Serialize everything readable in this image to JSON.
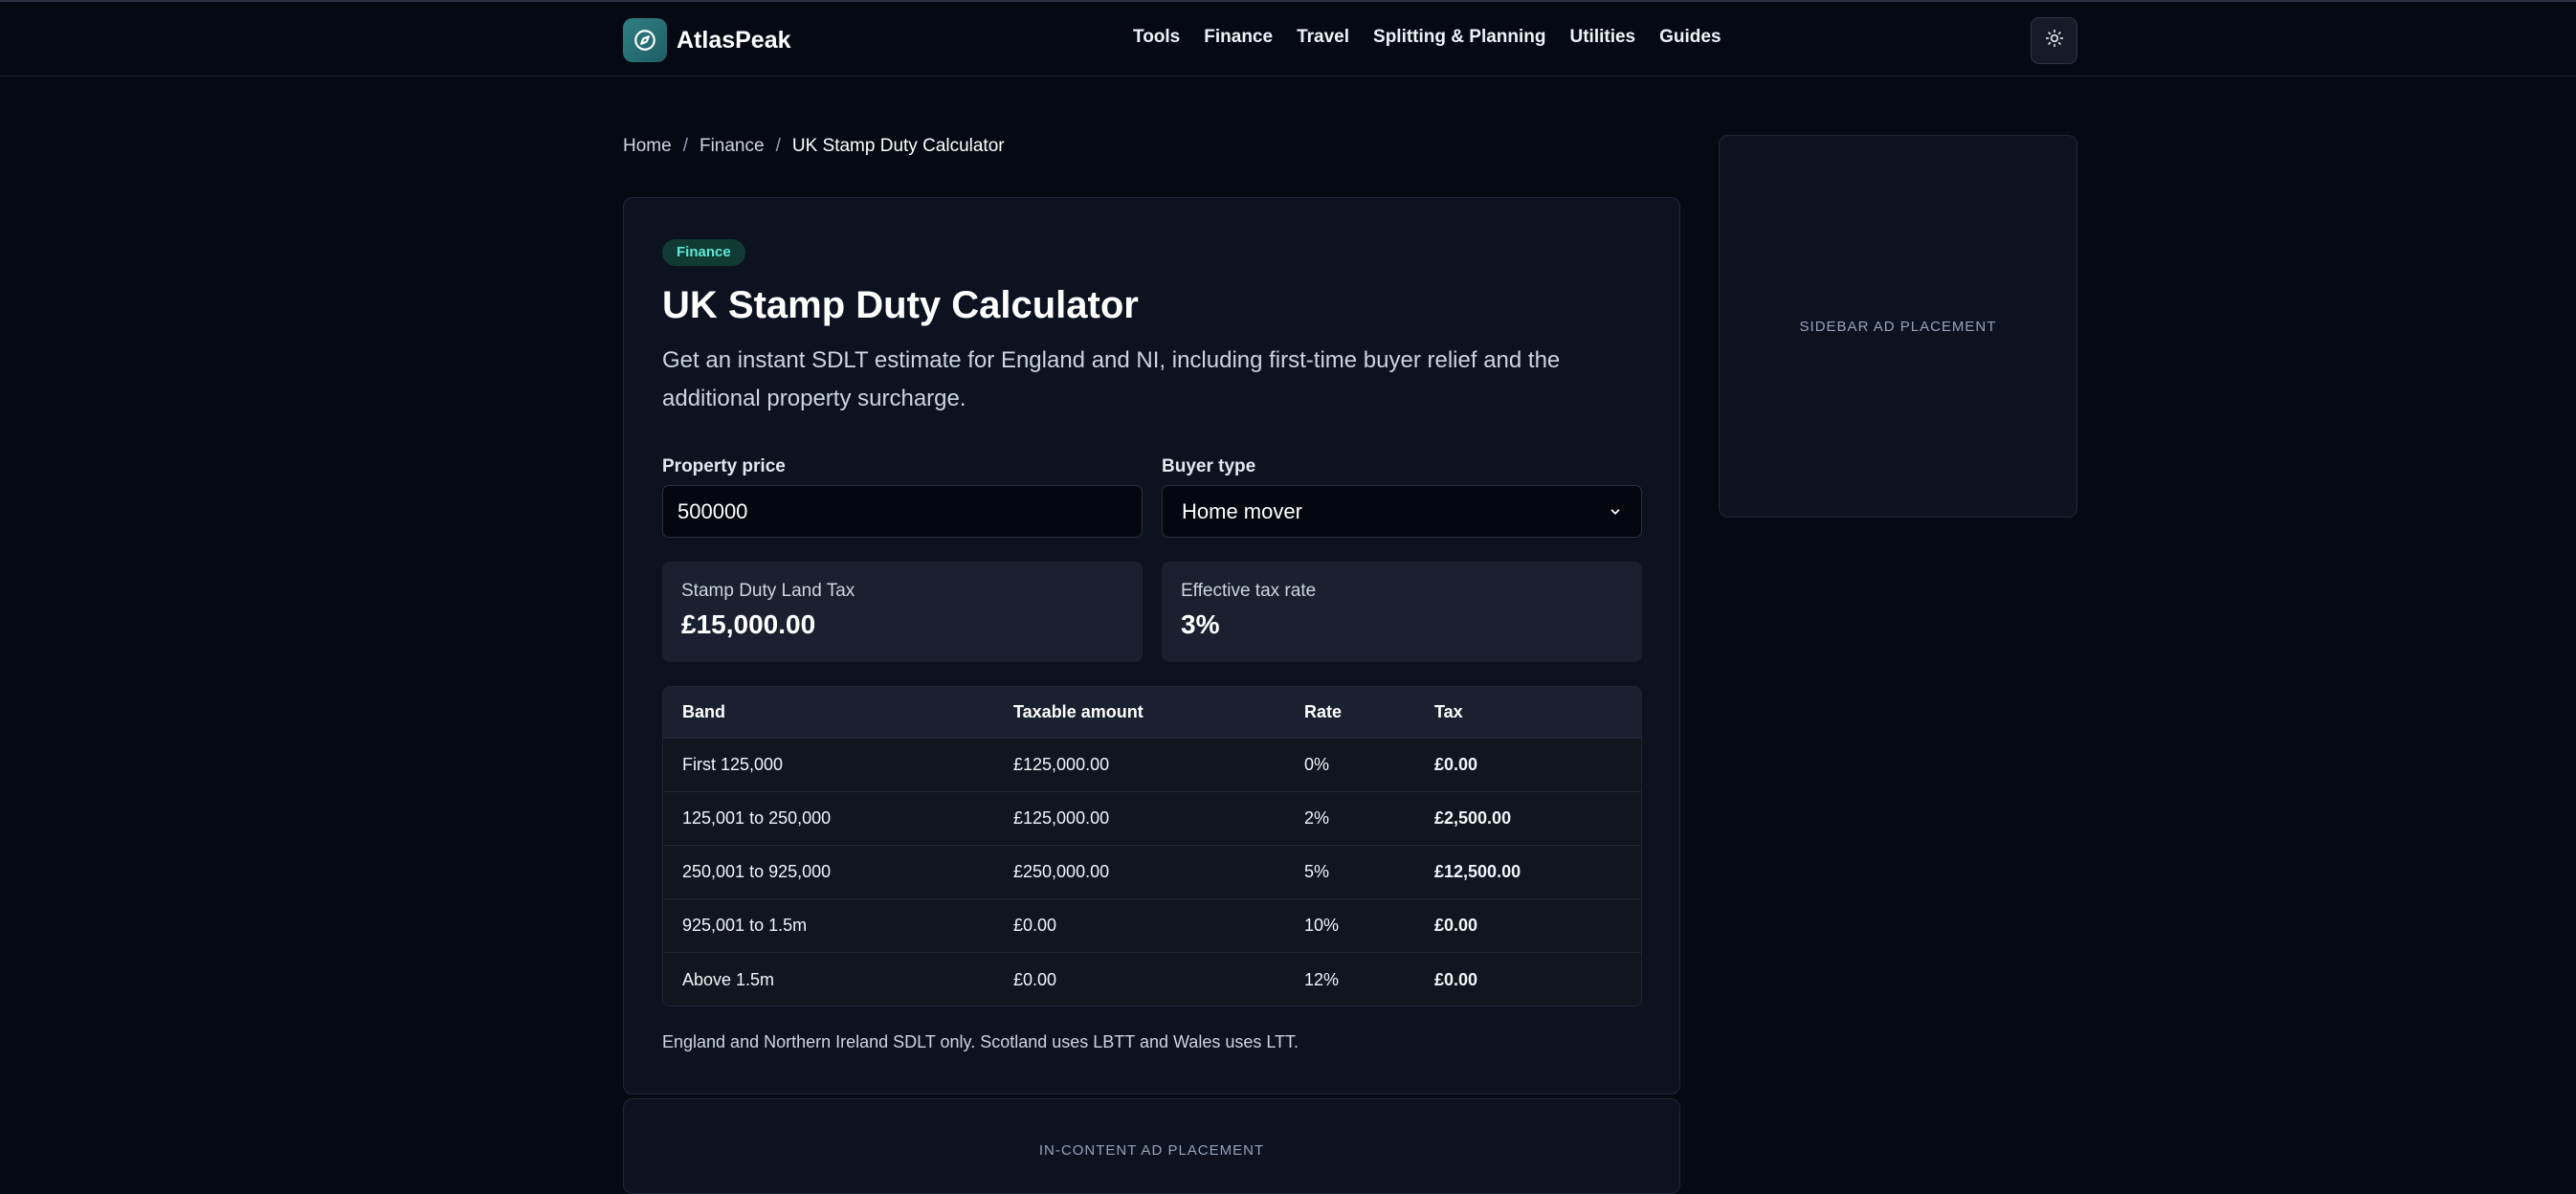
{
  "header": {
    "brand": "AtlasPeak",
    "brand_icon": "compass-icon",
    "nav": [
      "Tools",
      "Finance",
      "Travel",
      "Splitting & Planning",
      "Utilities",
      "Guides"
    ],
    "theme_icon": "sun-icon"
  },
  "breadcrumb": {
    "home": "Home",
    "section": "Finance",
    "current": "UK Stamp Duty Calculator",
    "separator": "/"
  },
  "calculator": {
    "badge": "Finance",
    "title": "UK Stamp Duty Calculator",
    "description": "Get an instant SDLT estimate for England and NI, including first-time buyer relief and the additional property surcharge.",
    "price_label": "Property price",
    "price_value": "500000",
    "buyer_label": "Buyer type",
    "buyer_value": "Home mover",
    "sdlt_label": "Stamp Duty Land Tax",
    "sdlt_value": "£15,000.00",
    "rate_label": "Effective tax rate",
    "rate_value": "3%",
    "table": {
      "headers": [
        "Band",
        "Taxable amount",
        "Rate",
        "Tax"
      ],
      "rows": [
        [
          "First 125,000",
          "£125,000.00",
          "0%",
          "£0.00"
        ],
        [
          "125,001 to 250,000",
          "£125,000.00",
          "2%",
          "£2,500.00"
        ],
        [
          "250,001 to 925,000",
          "£250,000.00",
          "5%",
          "£12,500.00"
        ],
        [
          "925,001 to 1.5m",
          "£0.00",
          "10%",
          "£0.00"
        ],
        [
          "Above 1.5m",
          "£0.00",
          "12%",
          "£0.00"
        ]
      ]
    },
    "footnote": "England and Northern Ireland SDLT only. Scotland uses LBTT and Wales uses LTT."
  },
  "ads": {
    "sidebar": "SIDEBAR AD PLACEMENT",
    "in_content": "IN-CONTENT AD PLACEMENT"
  },
  "colors": {
    "background": "#050914",
    "card": "#0d1221",
    "accent": "#2f7f82",
    "badge_text": "#5eead4"
  }
}
